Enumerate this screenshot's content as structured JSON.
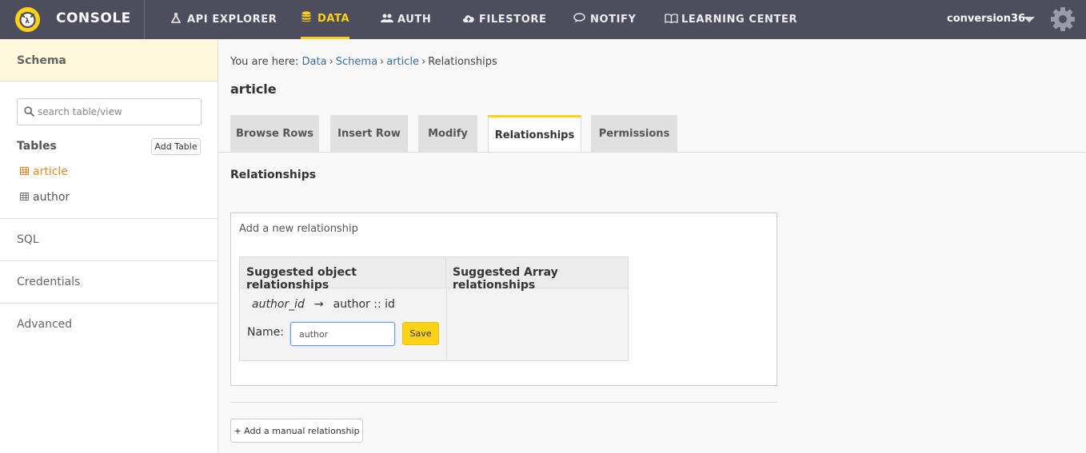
{
  "header": {
    "app_title": "CONSOLE",
    "nav": [
      {
        "label": "API EXPLORER",
        "icon": "flask-icon"
      },
      {
        "label": "DATA",
        "icon": "database-icon"
      },
      {
        "label": "AUTH",
        "icon": "users-icon"
      },
      {
        "label": "FILESTORE",
        "icon": "cloud-upload-icon"
      },
      {
        "label": "NOTIFY",
        "icon": "comment-icon"
      },
      {
        "label": "LEARNING CENTER",
        "icon": "book-icon"
      }
    ],
    "active_nav": "DATA",
    "user": "conversion36",
    "accent_color": "#fcd116"
  },
  "sidebar": {
    "title": "Schema",
    "search_placeholder": "search table/view",
    "tables_label": "Tables",
    "add_table_label": "Add Table",
    "tables": [
      "article",
      "author"
    ],
    "active_table": "article",
    "sections": [
      "SQL",
      "Credentials",
      "Advanced"
    ]
  },
  "main": {
    "breadcrumb": {
      "prefix": "You are here:",
      "items": [
        "Data",
        "Schema",
        "article"
      ],
      "current": "Relationships"
    },
    "title": "article",
    "tabs": [
      "Browse Rows",
      "Insert Row",
      "Modify",
      "Relationships",
      "Permissions"
    ],
    "active_tab": "Relationships",
    "section_title": "Relationships",
    "panel": {
      "title": "Add a new relationship",
      "col_object": "Suggested object relationships",
      "col_array": "Suggested Array relationships",
      "suggestion": {
        "from_column": "author_id",
        "arrow": "→",
        "to": "author :: id",
        "name_label": "Name:",
        "name_value": "author",
        "save_label": "Save"
      }
    },
    "manual_button": "+ Add a manual relationship"
  }
}
